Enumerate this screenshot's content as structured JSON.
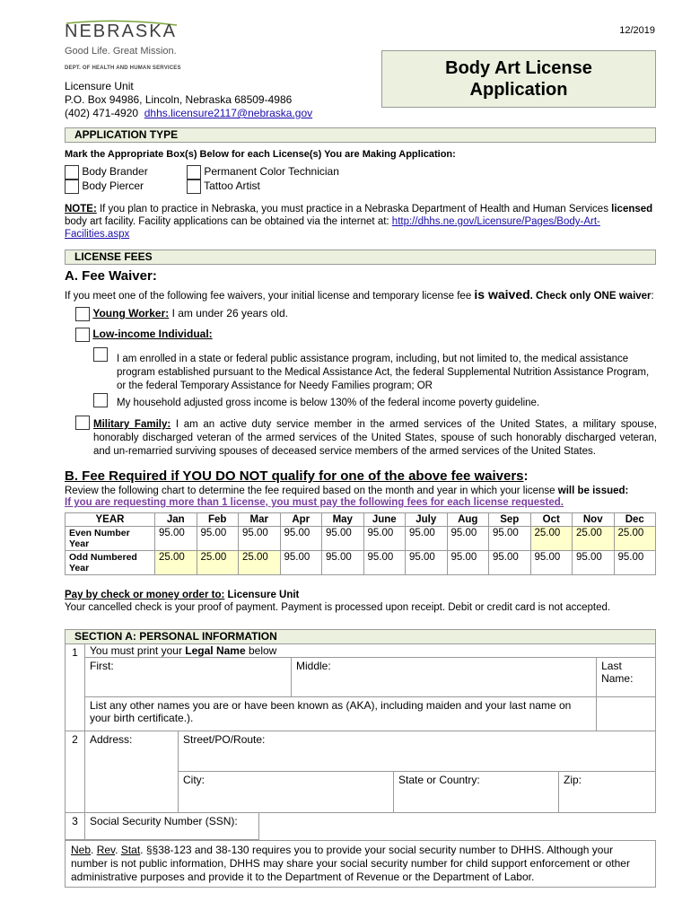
{
  "header": {
    "date": "12/2019",
    "logo": {
      "name": "NEBRASKA",
      "tagline": "Good Life. Great Mission.",
      "dept": "DEPT. OF HEALTH AND HUMAN SERVICES"
    },
    "address": {
      "unit": "Licensure Unit",
      "po": "P.O. Box 94986, Lincoln, Nebraska 68509-4986",
      "phone": "(402) 471-4920",
      "email": "dhhs.licensure2117@nebraska.gov"
    },
    "title_line1": "Body Art License",
    "title_line2": "Application"
  },
  "application_type": {
    "heading": "APPLICATION TYPE",
    "instruction": "Mark the Appropriate Box(s) Below for each License(s) You are Making Application:",
    "options": [
      "Body Brander",
      "Body Piercer",
      "Permanent Color Technician",
      "Tattoo Artist"
    ],
    "note_label": "NOTE:",
    "note_text1": " If you plan to practice in Nebraska, you must practice in a Nebraska Department of Health and Human Services ",
    "note_bold": "licensed",
    "note_text2": "body art facility.  Facility applications can be obtained via the internet at:  ",
    "note_link1": "http://dhhs.ne.gov/Licensure/Pages/Body-Art-",
    "note_link2": "Facilities.aspx"
  },
  "license_fees": {
    "heading": "LICENSE FEES",
    "waiver_heading": "A.  Fee Waiver:",
    "waiver_intro1": "If you meet one of the following fee waivers, your initial license and temporary license fee ",
    "waiver_intro_big": "is waived",
    "waiver_intro2": ".  Check only ONE waiver",
    "waiver_intro3": ":",
    "young_label": "Young Worker:",
    "young_text": " I am under 26 years old.",
    "lowincome_label": "Low-income Individual:",
    "lowincome_opt1": "I am enrolled in a state or federal public assistance program, including, but not limited to, the medical assistance program established pursuant to the Medical Assistance Act, the federal Supplemental Nutrition Assistance Program, or the federal Temporary Assistance for Needy Families program; OR",
    "lowincome_opt2": "My household adjusted gross income is below 130% of the federal income poverty guideline.",
    "military_label": "Military Family:",
    "military_text": " I am an active duty service member in the armed services of the United States, a military spouse, honorably discharged veteran of the armed services of the United States, spouse of such honorably discharged veteran, and un-remarried surviving spouses of deceased service members of the armed services of the United States.",
    "fee_heading": "B.  Fee Required if YOU DO NOT qualify for one of the above fee waivers",
    "fee_heading_colon": ":",
    "fee_intro1": "Review the following chart to determine the fee required based on the month and year in which your license ",
    "fee_intro_bold": "will be issued:",
    "fee_warning": "If you are requesting more than 1 license, you must pay the following fees for each license requested.",
    "table": {
      "header": [
        "YEAR",
        "Jan",
        "Feb",
        "Mar",
        "Apr",
        "May",
        "June",
        "July",
        "Aug",
        "Sep",
        "Oct",
        "Nov",
        "Dec"
      ],
      "rows": [
        {
          "label": "Even Number Year",
          "values": [
            "95.00",
            "95.00",
            "95.00",
            "95.00",
            "95.00",
            "95.00",
            "95.00",
            "95.00",
            "95.00",
            "25.00",
            "25.00",
            "25.00"
          ]
        },
        {
          "label": "Odd Numbered Year",
          "values": [
            "25.00",
            "25.00",
            "25.00",
            "95.00",
            "95.00",
            "95.00",
            "95.00",
            "95.00",
            "95.00",
            "95.00",
            "95.00",
            "95.00"
          ]
        }
      ],
      "highlight_color": "#ffffcc"
    },
    "pay_label": "Pay by check or money order to:",
    "pay_to": "  Licensure Unit",
    "pay_note": "Your cancelled check is your proof of payment.  Payment is processed upon receipt.  Debit or credit card is not accepted."
  },
  "section_a": {
    "heading": "SECTION A:  PERSONAL INFORMATION",
    "row1_num": "1",
    "legal_name_pre": "You must print your ",
    "legal_name_bold": "Legal Name",
    "legal_name_post": " below",
    "first": "First:",
    "middle": "Middle:",
    "last": "Last Name:",
    "aka": "List any other names you are or have been known as (AKA), including maiden and your last name on your birth certificate.).",
    "row2_num": "2",
    "address": "Address:",
    "street": "Street/PO/Route:",
    "city": "City:",
    "state": "State or Country:",
    "zip": "Zip:",
    "row3_num": "3",
    "ssn": "Social Security Number (SSN):",
    "ssn_note_neb": "Neb",
    "ssn_note_rev": "Rev",
    "ssn_note_stat": "Stat",
    "ssn_note_text": ". §§38-123 and 38-130 requires you to provide your social security number to DHHS.  Although your number is not public information, DHHS may share your social security number for child support enforcement or other administrative purposes and provide it to the Department of Revenue or the Department of Labor."
  }
}
